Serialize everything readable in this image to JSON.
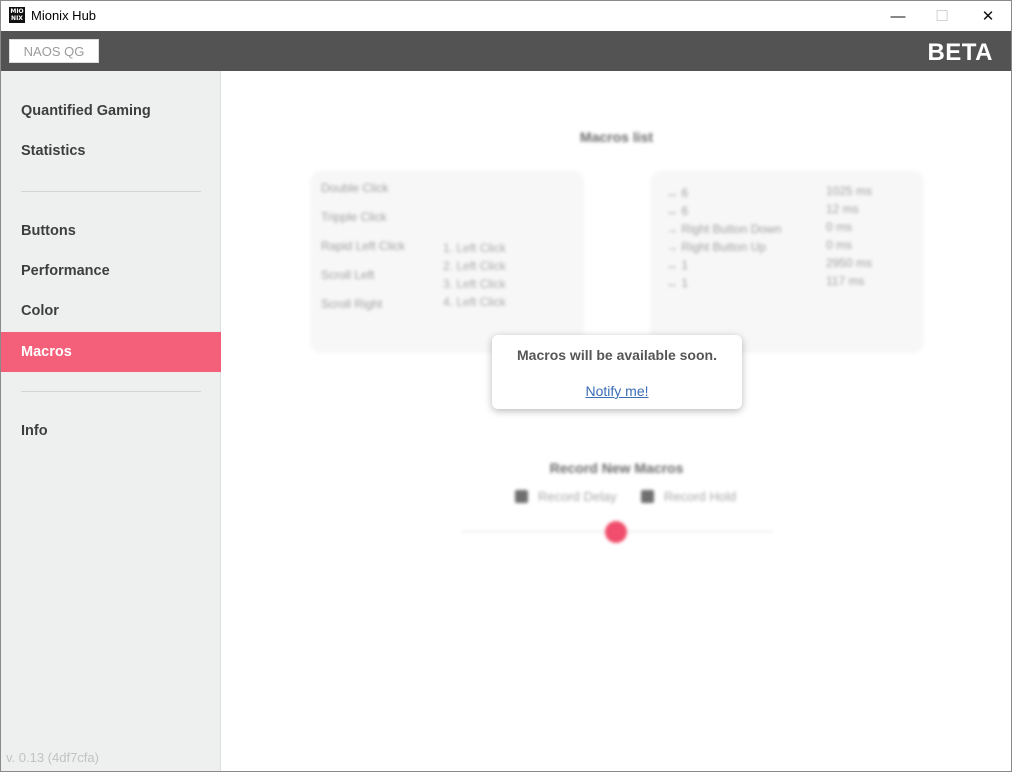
{
  "window": {
    "title": "Mionix Hub",
    "icon_text": "MIO NIX",
    "controls": {
      "minimize": "—",
      "maximize": "☐",
      "close": "✕"
    }
  },
  "header": {
    "device_button": "NAOS QG",
    "badge": "BETA"
  },
  "sidebar": {
    "items": [
      {
        "label": "Quantified Gaming"
      },
      {
        "label": "Statistics"
      },
      {
        "label": "Buttons"
      },
      {
        "label": "Performance"
      },
      {
        "label": "Color"
      },
      {
        "label": "Macros",
        "active": true
      },
      {
        "label": "Info"
      }
    ],
    "version": "v. 0.13 (4df7cfa)"
  },
  "main": {
    "macros_list_title": "Macros list",
    "macros": [
      {
        "name": "Double Click"
      },
      {
        "name": "Tripple Click"
      },
      {
        "name": "Rapid Left Click"
      },
      {
        "name": "Scroll Left"
      },
      {
        "name": "Scroll Right"
      }
    ],
    "steps": [
      "1. Left Click",
      "2. Left Click",
      "3. Left Click",
      "4. Left Click"
    ],
    "events": [
      {
        "name": "↔ 6",
        "time": "1025 ms"
      },
      {
        "name": "↔ 6",
        "time": "12 ms"
      },
      {
        "name": "→ Right Button Down",
        "time": "0 ms"
      },
      {
        "name": "→ Right Button Up",
        "time": "0 ms"
      },
      {
        "name": "↔ 1",
        "time": "2950 ms"
      },
      {
        "name": "↔ 1",
        "time": "117 ms"
      }
    ],
    "record_title": "Record New Macros",
    "record_delay_label": "Record Delay",
    "record_hold_label": "Record Hold"
  },
  "popup": {
    "message": "Macros will be available soon.",
    "link": "Notify me!"
  },
  "colors": {
    "accent": "#f45f7a",
    "header_bg": "#535353",
    "sidebar_bg": "#eef0ef",
    "link": "#3a6db5"
  }
}
